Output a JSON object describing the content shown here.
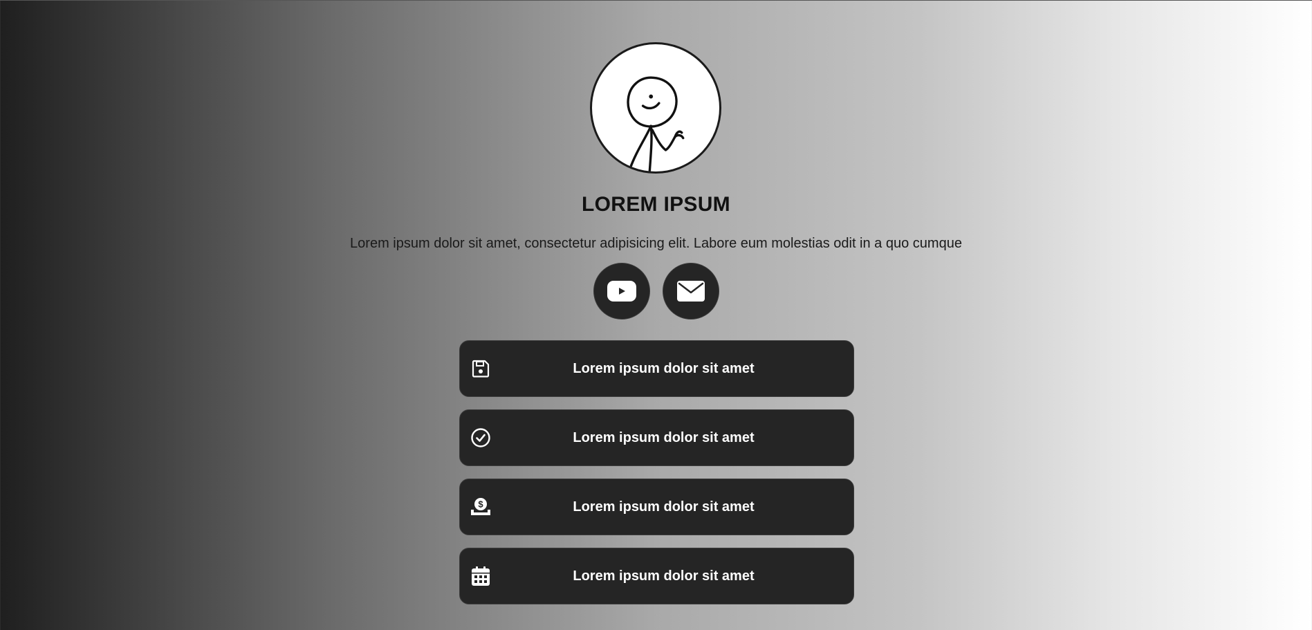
{
  "profile": {
    "name": "LOREM IPSUM",
    "bio": "Lorem ipsum dolor sit amet, consectetur adipisicing elit. Labore eum molestias odit in a quo cumque"
  },
  "socials": [
    {
      "icon": "youtube-icon"
    },
    {
      "icon": "envelope-icon"
    }
  ],
  "links": [
    {
      "label": "Lorem ipsum dolor sit amet",
      "icon": "floppy-disk-icon"
    },
    {
      "label": "Lorem ipsum dolor sit amet",
      "icon": "check-circle-icon"
    },
    {
      "label": "Lorem ipsum dolor sit amet",
      "icon": "money-hand-icon"
    },
    {
      "label": "Lorem ipsum dolor sit amet",
      "icon": "calendar-icon"
    }
  ],
  "colors": {
    "button_bg": "#252525",
    "text_light": "#ffffff",
    "text_dark": "#111111"
  }
}
